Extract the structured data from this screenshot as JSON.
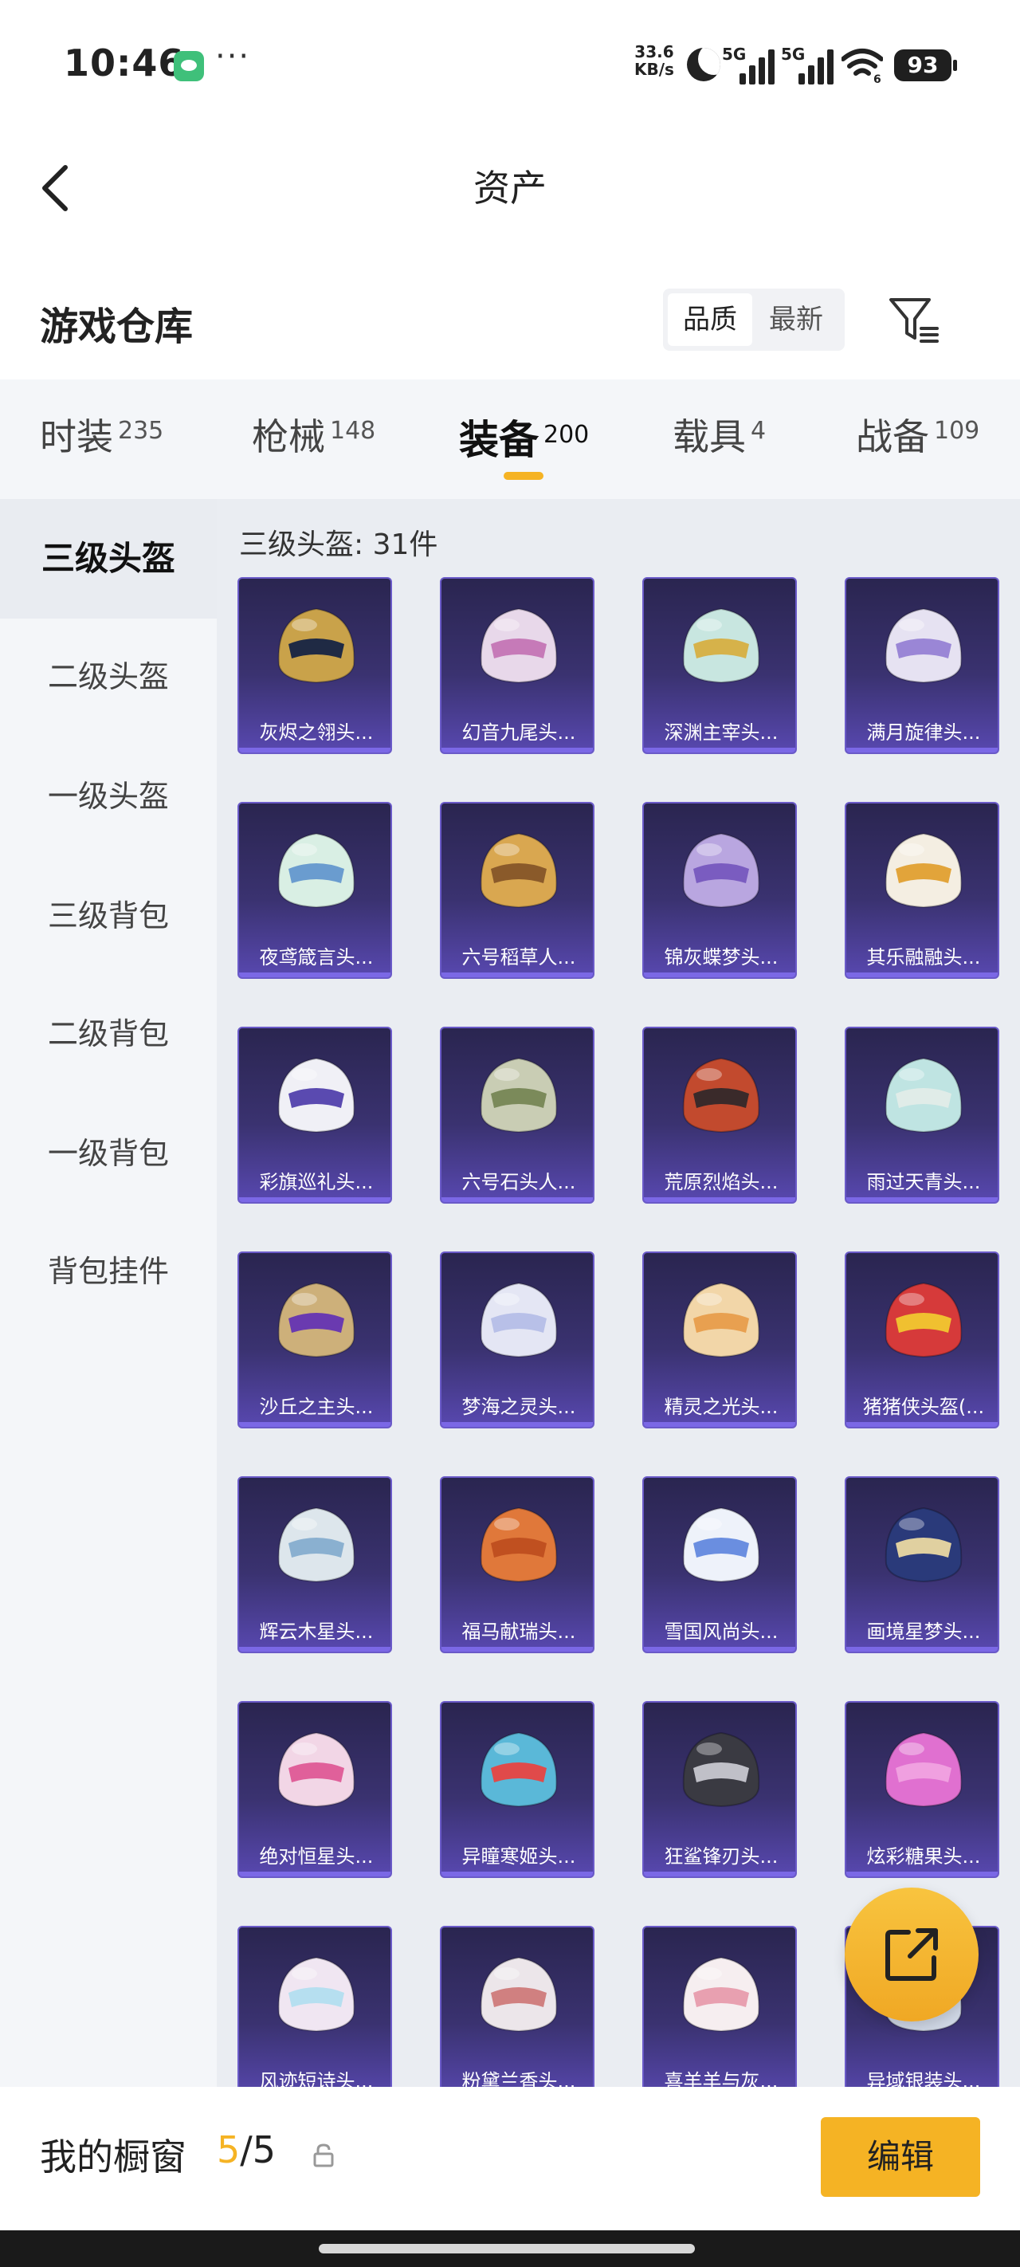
{
  "status_bar": {
    "time": "10:46",
    "net_speed_value": "33.6",
    "net_speed_unit": "KB/s",
    "signal1_label": "5G",
    "signal2_label": "5G",
    "wifi_badge": "6",
    "battery": "93"
  },
  "nav": {
    "title": "资产"
  },
  "warehouse": {
    "title": "游戏仓库",
    "sort_options": [
      "品质",
      "最新"
    ],
    "sort_selected": "品质"
  },
  "tabs": [
    {
      "label": "时装",
      "count": "235"
    },
    {
      "label": "枪械",
      "count": "148"
    },
    {
      "label": "装备",
      "count": "200",
      "active": true
    },
    {
      "label": "载具",
      "count": "4"
    },
    {
      "label": "战备",
      "count": "109"
    }
  ],
  "sidebar": {
    "items": [
      {
        "label": "三级头盔",
        "active": true
      },
      {
        "label": "二级头盔"
      },
      {
        "label": "一级头盔"
      },
      {
        "label": "三级背包"
      },
      {
        "label": "二级背包"
      },
      {
        "label": "一级背包"
      },
      {
        "label": "背包挂件"
      }
    ]
  },
  "content": {
    "section_title": "三级头盔: 31件",
    "items": [
      {
        "name": "灰烬之翎头...",
        "color": "#c9a24a",
        "accent": "#1f2a44"
      },
      {
        "name": "幻音九尾头...",
        "color": "#e8d8ea",
        "accent": "#c67ab8"
      },
      {
        "name": "深渊主宰头...",
        "color": "#c8e6e0",
        "accent": "#d6b24a"
      },
      {
        "name": "满月旋律头...",
        "color": "#e6e2f2",
        "accent": "#9a86d6"
      },
      {
        "name": "夜鸢箴言头...",
        "color": "#d9efe4",
        "accent": "#6a9ccf"
      },
      {
        "name": "六号稻草人...",
        "color": "#d9a750",
        "accent": "#8a5a2a"
      },
      {
        "name": "锦灰蝶梦头...",
        "color": "#b9a6e0",
        "accent": "#7a5cc0"
      },
      {
        "name": "其乐融融头...",
        "color": "#f4eee2",
        "accent": "#e2a43a"
      },
      {
        "name": "彩旗巡礼头...",
        "color": "#f0f0f6",
        "accent": "#5a4ab0"
      },
      {
        "name": "六号石头人...",
        "color": "#c9cdb4",
        "accent": "#7b8a5a"
      },
      {
        "name": "荒原烈焰头...",
        "color": "#c24a2e",
        "accent": "#3a2a2a"
      },
      {
        "name": "雨过天青头...",
        "color": "#bfe4e2",
        "accent": "#e0ece8"
      },
      {
        "name": "沙丘之主头...",
        "color": "#cdb07a",
        "accent": "#6a3ab0"
      },
      {
        "name": "梦海之灵头...",
        "color": "#e4e6f4",
        "accent": "#b8c0e8"
      },
      {
        "name": "精灵之光头...",
        "color": "#f2d6a8",
        "accent": "#e8a050"
      },
      {
        "name": "猪猪侠头盔(...",
        "color": "#d63a3a",
        "accent": "#f0c030"
      },
      {
        "name": "辉云木星头...",
        "color": "#dde6ec",
        "accent": "#8ab0d0"
      },
      {
        "name": "福马献瑞头...",
        "color": "#e0783a",
        "accent": "#c05020"
      },
      {
        "name": "雪国风尚头...",
        "color": "#eef2fa",
        "accent": "#6a8ee0"
      },
      {
        "name": "画境星梦头...",
        "color": "#2a3a7a",
        "accent": "#e0d0a0"
      },
      {
        "name": "绝对恒星头...",
        "color": "#f2d6e6",
        "accent": "#e0609a"
      },
      {
        "name": "异瞳寒姬头...",
        "color": "#5ab8d8",
        "accent": "#e04a4a"
      },
      {
        "name": "狂鲨锋刃头...",
        "color": "#3a3a42",
        "accent": "#c0c0c8"
      },
      {
        "name": "炫彩糖果头...",
        "color": "#e070d0",
        "accent": "#f0a0e0"
      },
      {
        "name": "风迹短诗头...",
        "color": "#f0e6f2",
        "accent": "#b6dff0"
      },
      {
        "name": "粉黛兰香头...",
        "color": "#ece6ea",
        "accent": "#d08080"
      },
      {
        "name": "喜羊羊与灰...",
        "color": "#f6eef0",
        "accent": "#e8a0b0"
      },
      {
        "name": "异域银装头...",
        "color": "#d0d8e6",
        "accent": "#8a9ac0"
      }
    ]
  },
  "fab": {
    "icon": "share-external-icon"
  },
  "bottom_bar": {
    "label": "我的橱窗",
    "count_current": "5",
    "count_separator": "/",
    "count_max": "5",
    "edit_label": "编辑"
  }
}
